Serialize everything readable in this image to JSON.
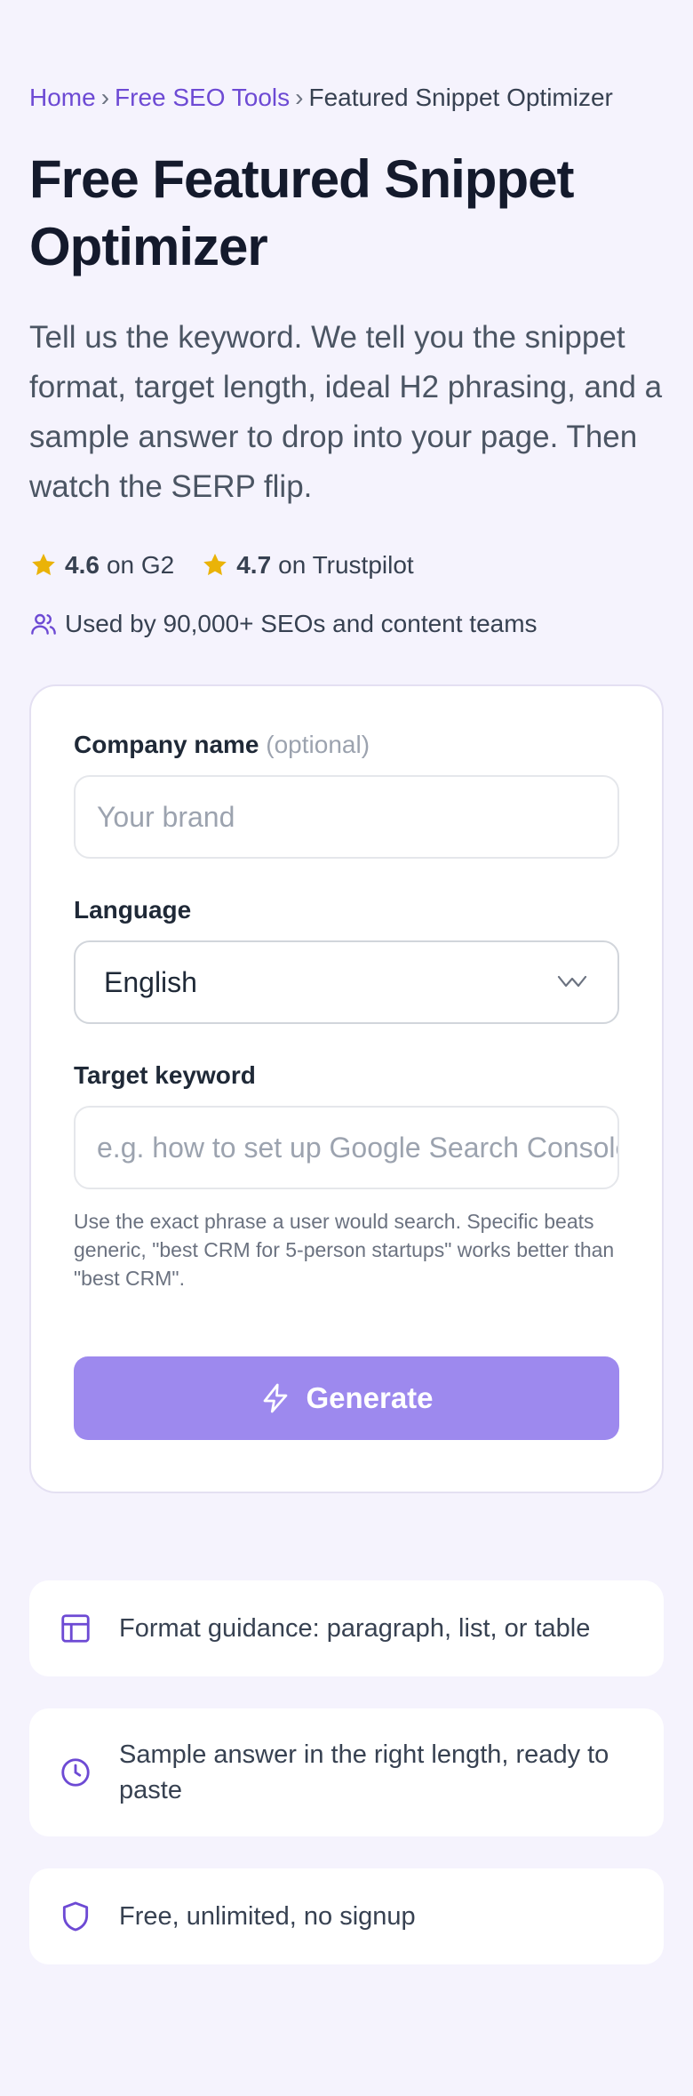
{
  "breadcrumb": {
    "home": "Home",
    "tools": "Free SEO Tools",
    "current": "Featured Snippet Optimizer",
    "separator": "›"
  },
  "hero": {
    "title": "Free Featured Snippet Optimizer",
    "subtitle": "Tell us the keyword. We tell you the snippet format, target length, ideal H2 phrasing, and a sample answer to drop into your page. Then watch the SERP flip."
  },
  "ratings": [
    {
      "score": "4.6",
      "source": "on G2",
      "icon": "star-icon"
    },
    {
      "score": "4.7",
      "source": "on Trustpilot",
      "icon": "star-icon"
    }
  ],
  "users_text": "Used by 90,000+ SEOs and content teams",
  "form": {
    "company": {
      "label": "Company name",
      "optional": "(optional)",
      "placeholder": "Your brand",
      "value": ""
    },
    "language": {
      "label": "Language",
      "value": "English"
    },
    "keyword": {
      "label": "Target keyword",
      "placeholder": "e.g. how to set up Google Search Console",
      "hint": "Use the exact phrase a user would search. Specific beats generic, \"best CRM for 5-person startups\" works better than \"best CRM\"."
    },
    "submit_label": "Generate"
  },
  "features": [
    {
      "icon": "layout-icon",
      "text": "Format guidance: paragraph, list, or table"
    },
    {
      "icon": "clock-icon",
      "text": "Sample answer in the right length, ready to paste"
    },
    {
      "icon": "shield-icon",
      "text": "Free, unlimited, no signup"
    }
  ],
  "colors": {
    "accent": "#6d4ad4",
    "button": "#9d89ee",
    "star": "#eab308",
    "background": "#f5f3fd"
  }
}
